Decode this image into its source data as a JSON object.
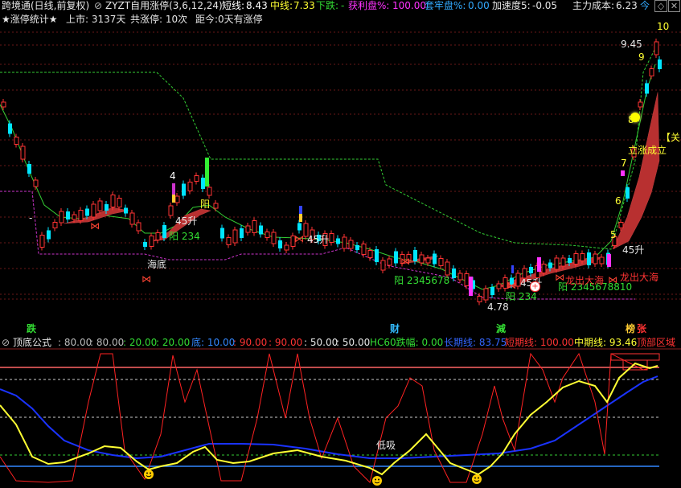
{
  "header": {
    "stock_name": "跨境通(日线,前复权)",
    "formula_name": "ZYZT自用涨停(3,6,12,24)",
    "short_label": "短线:",
    "short_value": "8.43",
    "mid_label": "中线:",
    "mid_value": "7.33",
    "fall_label": "下跌:",
    "fall_value": "-",
    "profit_label": "获利盘%:",
    "profit_value": "100.00",
    "trap_label": "套牢盘%:",
    "trap_value": "0.00",
    "accel_label": "加速度5:",
    "accel_value": "-0.05",
    "cost_label": "主力成本:",
    "cost_value": "6.23",
    "extra_value": "今"
  },
  "subheader": {
    "title": "★涨停统计★",
    "listed": "上市: 3137天",
    "limit_count": "共涨停: 10次",
    "since": "距今:0天有涨停"
  },
  "main_labels": {
    "price_high": "9.45",
    "price_low": "4.78",
    "haidi": "海底",
    "yang1": "阳 234",
    "yang2": "阳 2345678",
    "yang3": "阳 234",
    "yang4": "阳 2345678810",
    "yang_small": "阳",
    "rise1": "45升",
    "rise2": "45升",
    "rise3": "45升",
    "rise4": "45升",
    "dragon1": "龙出大海",
    "dragon2": "龙出大海",
    "lizhangchengli": "立涨成立",
    "guan": "【关",
    "dash": "-",
    "num4": "4",
    "num5": "5",
    "num6": "6",
    "num7": "7",
    "num8": "8",
    "num9": "9",
    "num10": "10"
  },
  "bottom_chips": [
    {
      "label": "跌",
      "color": "#33dd33"
    },
    {
      "label": "财",
      "color": "#33bbff"
    },
    {
      "label": "減",
      "color": "#33dd33"
    },
    {
      "label": "榜",
      "color": "#ffcc33"
    },
    {
      "label": "张",
      "color": "#ff3333"
    }
  ],
  "indicator": {
    "name": "顶底公式",
    "v1": ": 80.00",
    "v2": ": 80.00",
    "v3": ": 20.00",
    "v4": ": 20.00",
    "bottom_label": "底: 10.00",
    "v5": ": 90.00",
    "v6": ": 90.00",
    "v7": ": 50.00",
    "v8": ": 50.00",
    "hc60": "HC60跌幅: 0.00",
    "long_line": "长期线: 83.75",
    "short_line": "短期线: 100.00",
    "mid_line": "中期线: 93.46",
    "top_zone": "顶部区域",
    "dixi": "低吸"
  },
  "colors": {
    "up": "#ff3333",
    "down": "#00e5ff",
    "ma_green": "#33cc33",
    "band": "#b83030",
    "yellow": "#ffff33",
    "blue": "#1a33ff",
    "grid": "#8a1f1f"
  }
}
